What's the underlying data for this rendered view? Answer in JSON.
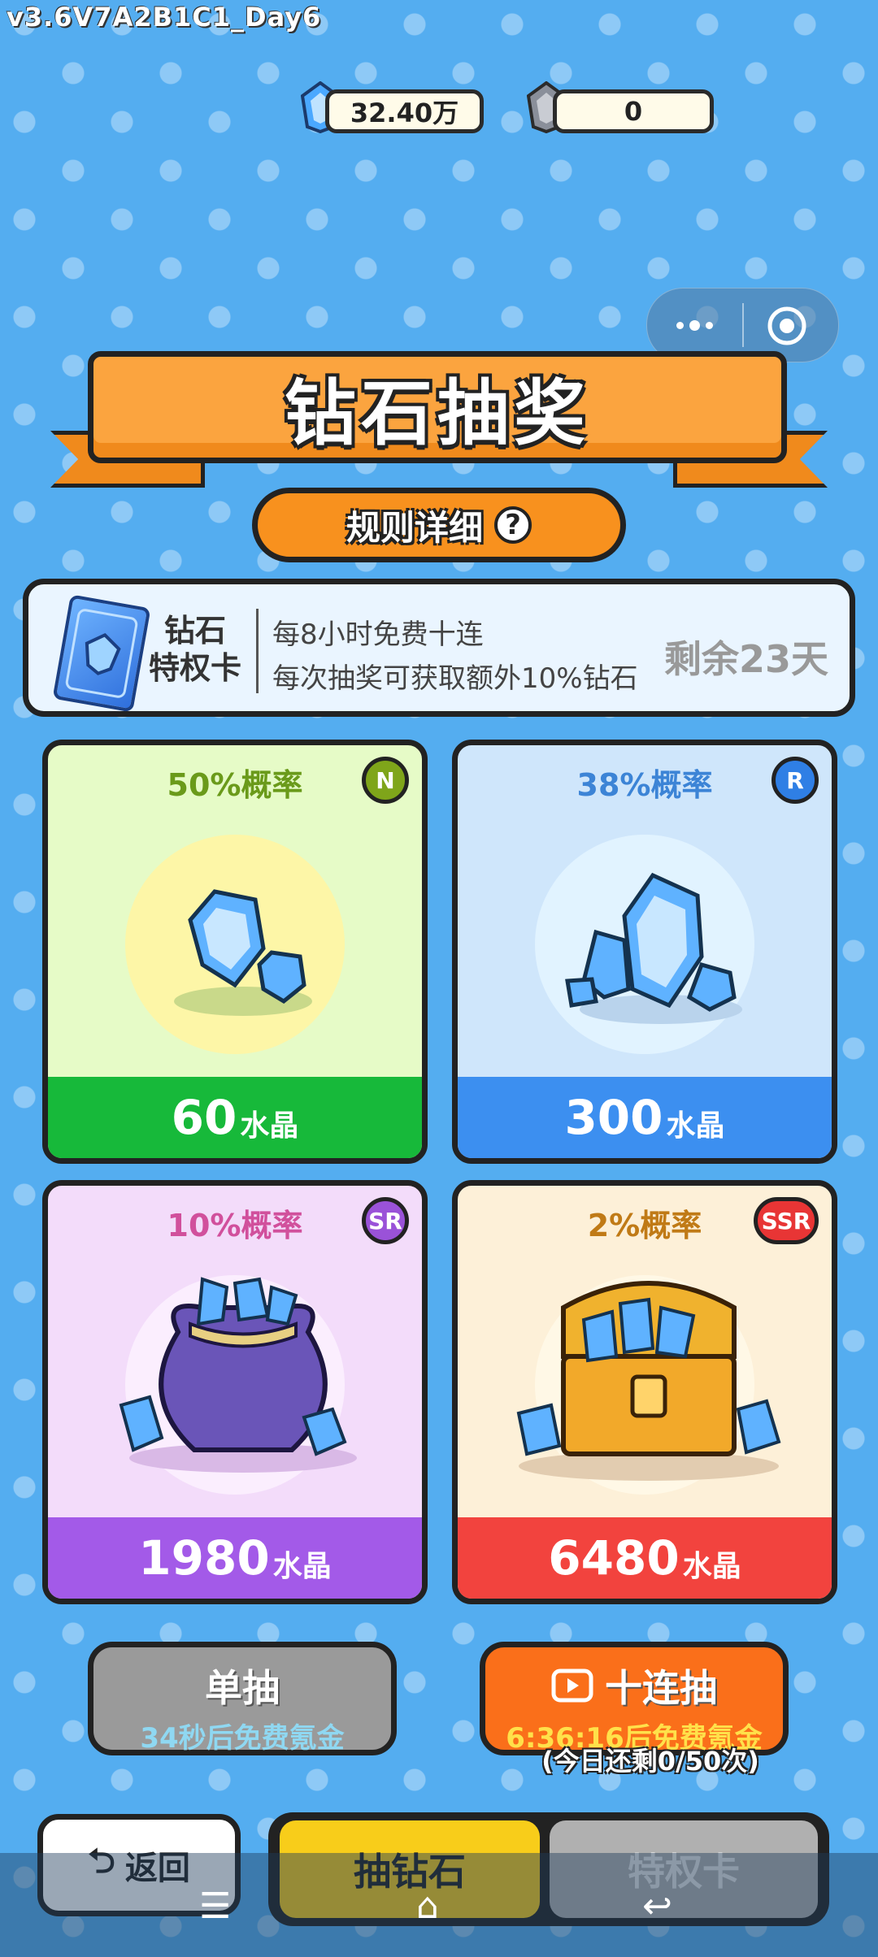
{
  "version": "v3.6V7A2B1C1_Day6",
  "currency": {
    "crystal": "32.40万",
    "shard": "0"
  },
  "title": "钻石抽奖",
  "rules_label": "规则详细",
  "vip": {
    "title_line1": "钻石",
    "title_line2": "特权卡",
    "desc_line1": "每8小时免费十连",
    "desc_line2": "每次抽奖可获取额外10%钻石",
    "remaining": "剩余23天"
  },
  "cards": [
    {
      "probability": "50%概率",
      "rarity": "N",
      "amount": "60",
      "unit": "水晶"
    },
    {
      "probability": "38%概率",
      "rarity": "R",
      "amount": "300",
      "unit": "水晶"
    },
    {
      "probability": "10%概率",
      "rarity": "SR",
      "amount": "1980",
      "unit": "水晶"
    },
    {
      "probability": "2%概率",
      "rarity": "SSR",
      "amount": "6480",
      "unit": "水晶"
    }
  ],
  "single_draw": {
    "label": "单抽",
    "sub": "34秒后免费氪金"
  },
  "ten_draw": {
    "label": "十连抽",
    "sub": "6:36:16后免费氪金",
    "note": "(今日还剩0/50次)"
  },
  "bottom": {
    "back": "返回",
    "tab_active": "抽钻石",
    "tab_inactive": "特权卡"
  },
  "colors": {
    "N": "#14b73a",
    "R": "#3c8ff0",
    "SR": "#a35ae8",
    "SSR": "#f2433e",
    "accent": "#f8911e"
  }
}
